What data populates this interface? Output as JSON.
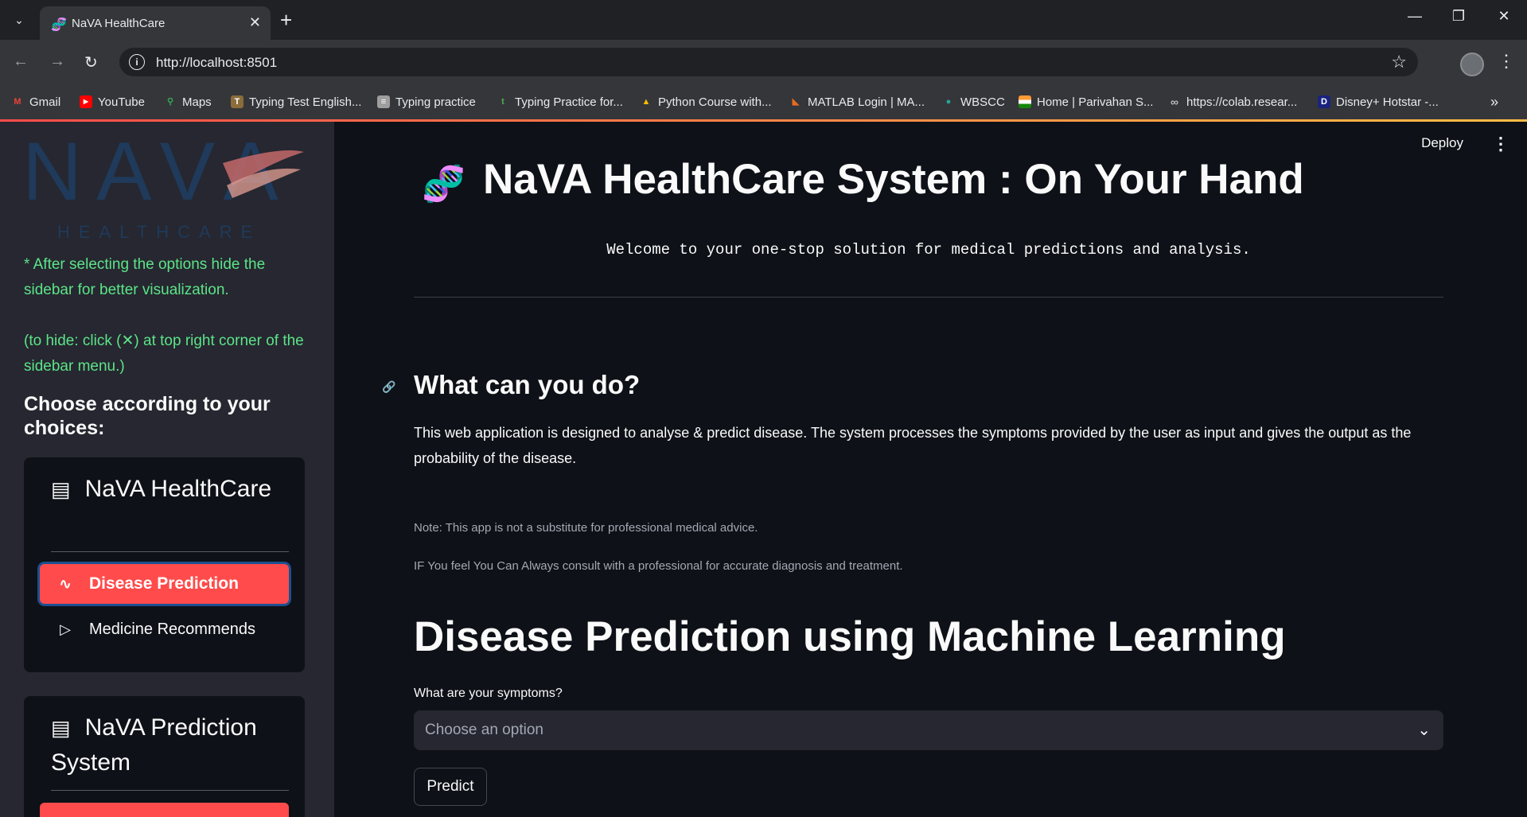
{
  "browser": {
    "tab_title": "NaVA HealthCare",
    "url": "http://localhost:8501",
    "bookmarks": [
      {
        "label": "Gmail",
        "icon": "gmail-icon",
        "color": "#ea4335",
        "glyph": "M"
      },
      {
        "label": "YouTube",
        "icon": "youtube-icon",
        "color": "#ff0000",
        "glyph": "▶"
      },
      {
        "label": "Maps",
        "icon": "maps-icon",
        "color": "#34a853",
        "glyph": "⚲"
      },
      {
        "label": "Typing Test English...",
        "icon": "typing-test-icon",
        "color": "#8a6d3b",
        "glyph": "T"
      },
      {
        "label": "Typing practice",
        "icon": "typing-practice-icon",
        "color": "#9e9e9e",
        "glyph": "≡"
      },
      {
        "label": "Typing Practice for...",
        "icon": "typing-practice-for-icon",
        "color": "#4caf50",
        "glyph": "t"
      },
      {
        "label": "Python Course with...",
        "icon": "google-drive-icon",
        "color": "#1e88e5",
        "glyph": "▲"
      },
      {
        "label": "MATLAB Login | MA...",
        "icon": "matlab-icon",
        "color": "#e86b1f",
        "glyph": "◣"
      },
      {
        "label": "WBSCC",
        "icon": "wbscc-icon",
        "color": "#26a69a",
        "glyph": "●"
      },
      {
        "label": "Home | Parivahan S...",
        "icon": "india-flag-icon",
        "color": "#ff9933",
        "glyph": "■"
      },
      {
        "label": "https://colab.resear...",
        "icon": "colab-icon",
        "color": "#9e9e9e",
        "glyph": "∞"
      },
      {
        "label": "Disney+ Hotstar -...",
        "icon": "hotstar-icon",
        "color": "#1a237e",
        "glyph": "D"
      }
    ]
  },
  "sidebar": {
    "logo_text": "NAVA",
    "logo_subtext": "HEALTHCARE",
    "note_1": "* After selecting the options hide the sidebar for better visualization.",
    "note_2": "(to hide: click (✕) at top right corner of the sidebar menu.)",
    "choose_heading": "Choose according to your choices:",
    "menu_1": {
      "title": "NaVA HealthCare",
      "items": [
        {
          "label": "Disease Prediction",
          "icon": "pulse-icon",
          "active": true
        },
        {
          "label": "Medicine Recommends",
          "icon": "play-outline-icon",
          "active": false
        }
      ]
    },
    "menu_2": {
      "title": "NaVA Prediction System"
    }
  },
  "header": {
    "deploy_label": "Deploy"
  },
  "main": {
    "title": "NaVA HealthCare System : On Your Hand",
    "welcome": "Welcome to your one-stop solution for medical predictions and analysis.",
    "section_heading": "What can you do?",
    "description": "This web application is designed to analyse & predict disease. The system processes the symptoms provided by the user as input and gives the output as the probability of the disease.",
    "note_1": "Note: This app is not a substitute for professional medical advice.",
    "note_2": "IF You feel You Can Always consult with a professional for accurate diagnosis and treatment.",
    "ml_heading": "Disease Prediction using Machine Learning",
    "symptom_label": "What are your symptoms?",
    "select_placeholder": "Choose an option",
    "predict_label": "Predict"
  }
}
